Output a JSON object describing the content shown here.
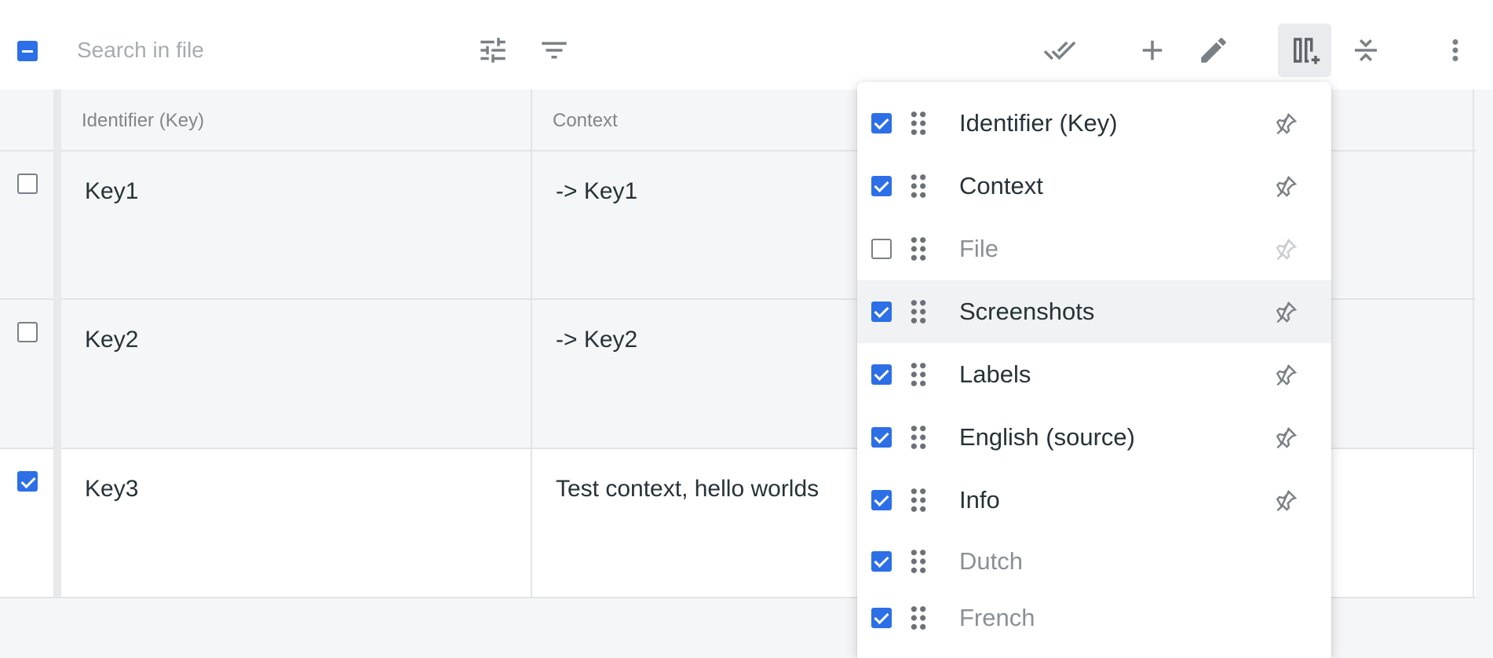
{
  "toolbar": {
    "search_placeholder": "Search in file",
    "icons": [
      "select-all-indeterminate",
      "tune-icon",
      "filter-icon",
      "done-all-icon",
      "add-icon",
      "edit-icon",
      "add-column-icon",
      "collapse-rows-icon",
      "more-vert-icon"
    ]
  },
  "grid": {
    "columns": [
      "Identifier (Key)",
      "Context"
    ],
    "rows": [
      {
        "key": "Key1",
        "context": "-> Key1",
        "checked": false
      },
      {
        "key": "Key2",
        "context": "-> Key2",
        "checked": false
      },
      {
        "key": "Key3",
        "context": "Test context, hello worlds",
        "checked": true
      }
    ]
  },
  "column_menu": {
    "items": [
      {
        "label": "Identifier (Key)",
        "checked": true,
        "pinnable": true
      },
      {
        "label": "Context",
        "checked": true,
        "pinnable": true
      },
      {
        "label": "File",
        "checked": false,
        "pinnable": true
      },
      {
        "label": "Screenshots",
        "checked": true,
        "pinnable": true,
        "hovered": true
      },
      {
        "label": "Labels",
        "checked": true,
        "pinnable": true
      },
      {
        "label": "English (source)",
        "checked": true,
        "pinnable": true
      },
      {
        "label": "Info",
        "checked": true,
        "pinnable": true
      },
      {
        "label": "Dutch",
        "checked": true,
        "pinnable": false
      },
      {
        "label": "French",
        "checked": true,
        "pinnable": false
      }
    ]
  },
  "colors": {
    "accent": "#2c6fe6",
    "icon": "#7a8086",
    "grid_bg": "#f5f6f7"
  }
}
